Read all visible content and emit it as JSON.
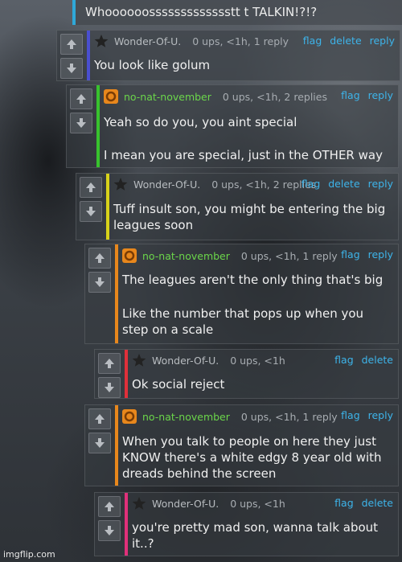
{
  "top_comment": {
    "text": "Whoooooossssssssssssstt t TALKIN!?!?"
  },
  "icons": {
    "upvote": "up-arrow-icon",
    "downvote": "down-arrow-icon",
    "star": "star-avatar-icon",
    "orange": "orange-avatar-icon"
  },
  "colors": {
    "blue": "#2fa8d8",
    "indigo": "#4a4fd0",
    "green": "#38c22e",
    "yellow": "#d7d21a",
    "orange": "#e8871c",
    "red": "#e0303a",
    "pink": "#e0307a"
  },
  "comments": [
    {
      "user": "Wonder-Of-U.",
      "stats": "0 ups, <1h, 1 reply",
      "flag": "flag",
      "delete": "delete",
      "reply": "reply",
      "lines": [
        "You look like golum"
      ]
    },
    {
      "user": "no-nat-november",
      "stats": "0 ups, <1h, 2 replies",
      "flag": "flag",
      "reply": "reply",
      "lines": [
        "Yeah so do you, you aint special",
        "I mean you are special, just in the OTHER way"
      ]
    },
    {
      "user": "Wonder-Of-U.",
      "stats": "0 ups, <1h, 2 replies",
      "flag": "flag",
      "delete": "delete",
      "reply": "reply",
      "lines": [
        "Tuff insult son, you might be entering the big leagues soon"
      ]
    },
    {
      "user": "no-nat-november",
      "stats": "0 ups, <1h, 1 reply",
      "flag": "flag",
      "reply": "reply",
      "lines": [
        "The leagues aren't the only thing that's big",
        "Like the number that pops up when you step on a scale"
      ]
    },
    {
      "user": "Wonder-Of-U.",
      "stats": "0 ups, <1h",
      "flag": "flag",
      "delete": "delete",
      "lines": [
        "Ok social reject"
      ]
    },
    {
      "user": "no-nat-november",
      "stats": "0 ups, <1h, 1 reply",
      "flag": "flag",
      "reply": "reply",
      "lines": [
        "When you talk to people on here they just KNOW there's a white edgy 8 year old with dreads behind the screen"
      ]
    },
    {
      "user": "Wonder-Of-U.",
      "stats": "0 ups, <1h",
      "flag": "flag",
      "delete": "delete",
      "lines": [
        "you're pretty mad son, wanna talk about it..?"
      ]
    }
  ],
  "watermark": "imgflip.com"
}
